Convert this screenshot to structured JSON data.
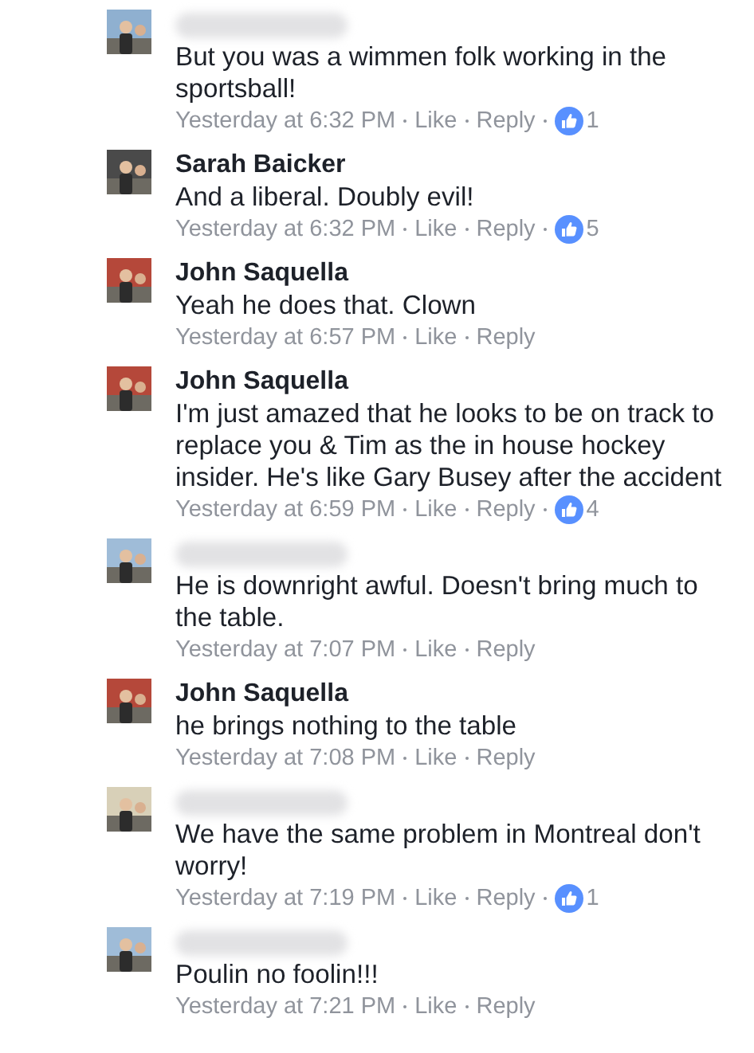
{
  "comments": [
    {
      "name_blurred": true,
      "text": "But you was a wimmen folk working in the sportsball!",
      "time": "Yesterday at 6:32 PM",
      "like": "Like",
      "reply": "Reply",
      "reactions": "1"
    },
    {
      "name_blurred": false,
      "author": "Sarah Baicker",
      "text": "And a liberal. Doubly evil!",
      "time": "Yesterday at 6:32 PM",
      "like": "Like",
      "reply": "Reply",
      "reactions": "5"
    },
    {
      "name_blurred": false,
      "author": "John Saquella",
      "text": "Yeah he does that. Clown",
      "time": "Yesterday at 6:57 PM",
      "like": "Like",
      "reply": "Reply"
    },
    {
      "name_blurred": false,
      "author": "John Saquella",
      "text": "I'm just amazed that he looks to be on track to replace you & Tim as the in house hockey insider. He's like Gary Busey after the accident",
      "time": "Yesterday at 6:59 PM",
      "like": "Like",
      "reply": "Reply",
      "reactions": "4"
    },
    {
      "name_blurred": true,
      "text": "He is downright awful. Doesn't bring much to the table.",
      "time": "Yesterday at 7:07 PM",
      "like": "Like",
      "reply": "Reply"
    },
    {
      "name_blurred": false,
      "author": "John Saquella",
      "text": "he brings nothing to the table",
      "time": "Yesterday at 7:08 PM",
      "like": "Like",
      "reply": "Reply"
    },
    {
      "name_blurred": true,
      "text": "We have the same problem in Montreal don't worry!",
      "time": "Yesterday at 7:19 PM",
      "like": "Like",
      "reply": "Reply",
      "reactions": "1"
    },
    {
      "name_blurred": true,
      "text": "Poulin no foolin!!!",
      "time": "Yesterday at 7:21 PM",
      "like": "Like",
      "reply": "Reply"
    }
  ]
}
